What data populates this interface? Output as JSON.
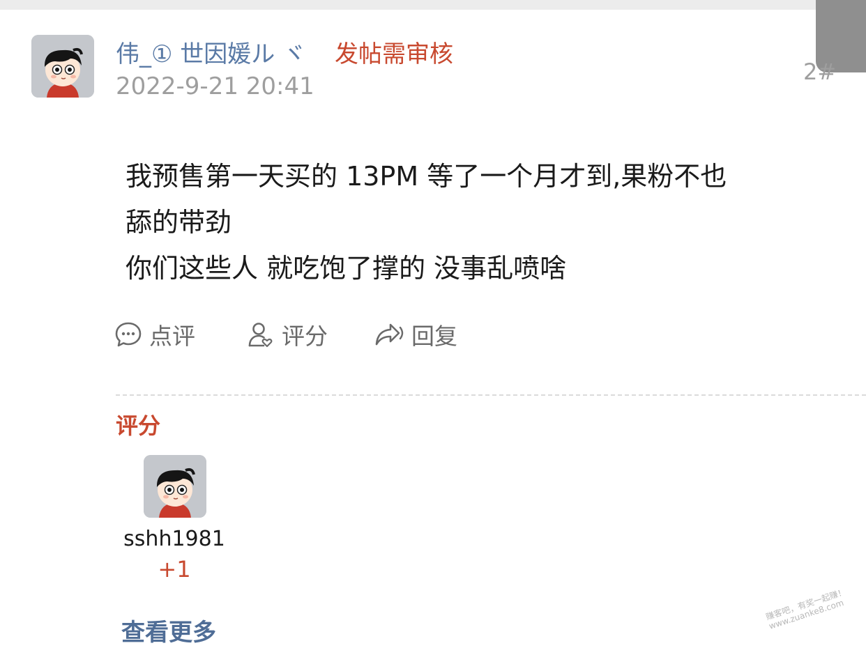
{
  "post": {
    "author": "伟_① 世因媛ル ヾ",
    "review_status": "发帖需审核",
    "timestamp": "2022-9-21 20:41",
    "floor": "2#",
    "content_lines": [
      "我预售第一天买的 13PM  等了一个月才到,果粉不也",
      "舔的带劲",
      "你们这些人 就吃饱了撑的 没事乱喷啥"
    ]
  },
  "actions": {
    "comment_label": "点评",
    "rate_label": "评分",
    "reply_label": "回复"
  },
  "rating": {
    "title": "评分",
    "raters": [
      {
        "name": "sshh1981",
        "score": "+1"
      }
    ],
    "more_label": "查看更多"
  },
  "watermark": {
    "line1": "赚客吧，有奖一起赚！",
    "line2": "www.zuanke8.com"
  },
  "colors": {
    "username": "#5a7aa6",
    "accent_red": "#c8492f",
    "link_blue": "#4f6d96",
    "meta_gray": "#9e9e9e"
  },
  "icons": [
    "comment-icon",
    "rate-user-icon",
    "reply-share-icon",
    "avatar"
  ]
}
